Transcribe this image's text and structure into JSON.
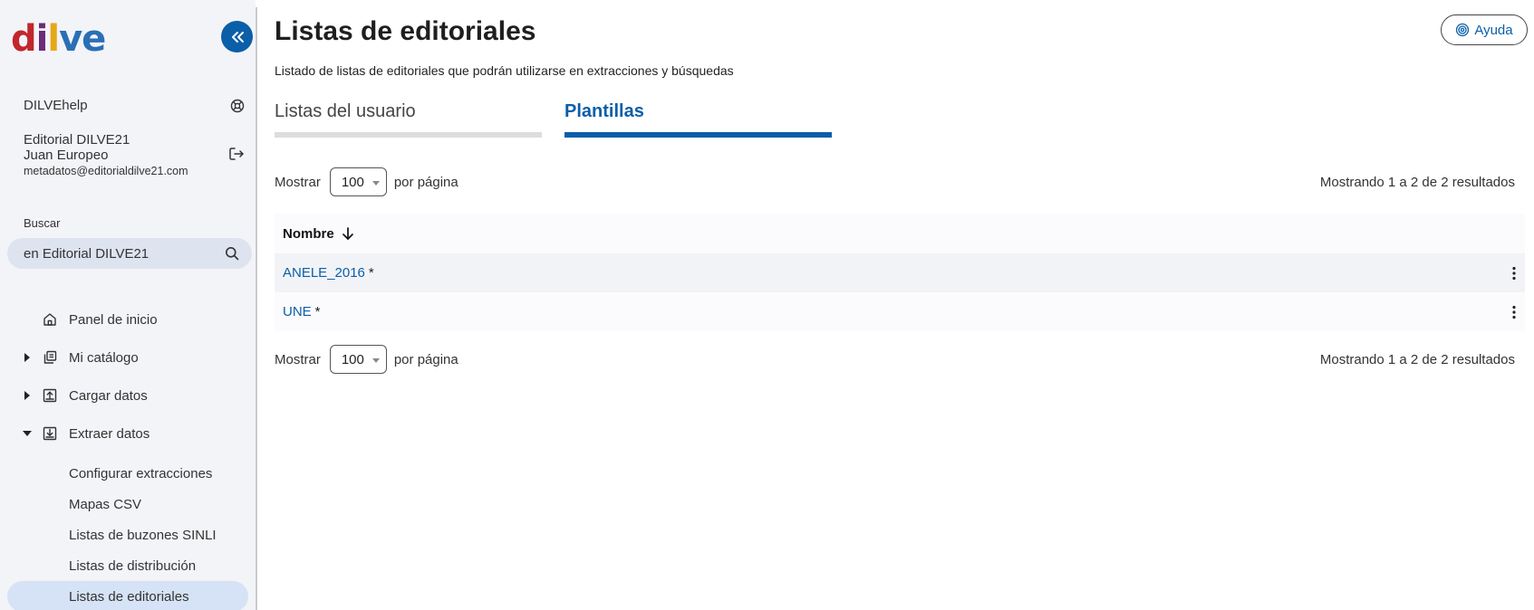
{
  "logo": {
    "parts": [
      "d",
      "i",
      "l",
      "ve"
    ]
  },
  "sidebar": {
    "help_label": "DILVEhelp",
    "org": "Editorial DILVE21",
    "user": "Juan Europeo",
    "email": "metadatos@editorialdilve21.com",
    "search_label": "Buscar",
    "search_value": "en Editorial DILVE21",
    "nav": [
      {
        "label": "Panel de inicio",
        "icon": "home-icon"
      },
      {
        "label": "Mi catálogo",
        "icon": "catalog-icon",
        "expanded": false
      },
      {
        "label": "Cargar datos",
        "icon": "upload-icon",
        "expanded": false
      },
      {
        "label": "Extraer datos",
        "icon": "download-icon",
        "expanded": true
      }
    ],
    "sub_items": [
      "Configurar extracciones",
      "Mapas CSV",
      "Listas de buzones SINLI",
      "Listas de distribución",
      "Listas de editoriales"
    ]
  },
  "main": {
    "title": "Listas de editoriales",
    "subtitle": "Listado de listas de editoriales que podrán utilizarse en extracciones y búsquedas",
    "help_button": "Ayuda",
    "tabs": [
      {
        "label": "Listas del usuario",
        "active": false
      },
      {
        "label": "Plantillas",
        "active": true
      }
    ],
    "pager": {
      "show_label": "Mostrar",
      "per_page_value": "100",
      "per_page_suffix": "por página",
      "results_text": "Mostrando 1 a 2 de 2 resultados"
    },
    "table": {
      "column_name": "Nombre",
      "rows": [
        {
          "name": "ANELE_2016",
          "marker": "*"
        },
        {
          "name": "UNE",
          "marker": "*"
        }
      ]
    }
  },
  "colors": {
    "accent": "#0b5ea8",
    "sidebar_bg": "#f3f4f8",
    "active_item_bg": "#d6e2f5"
  }
}
